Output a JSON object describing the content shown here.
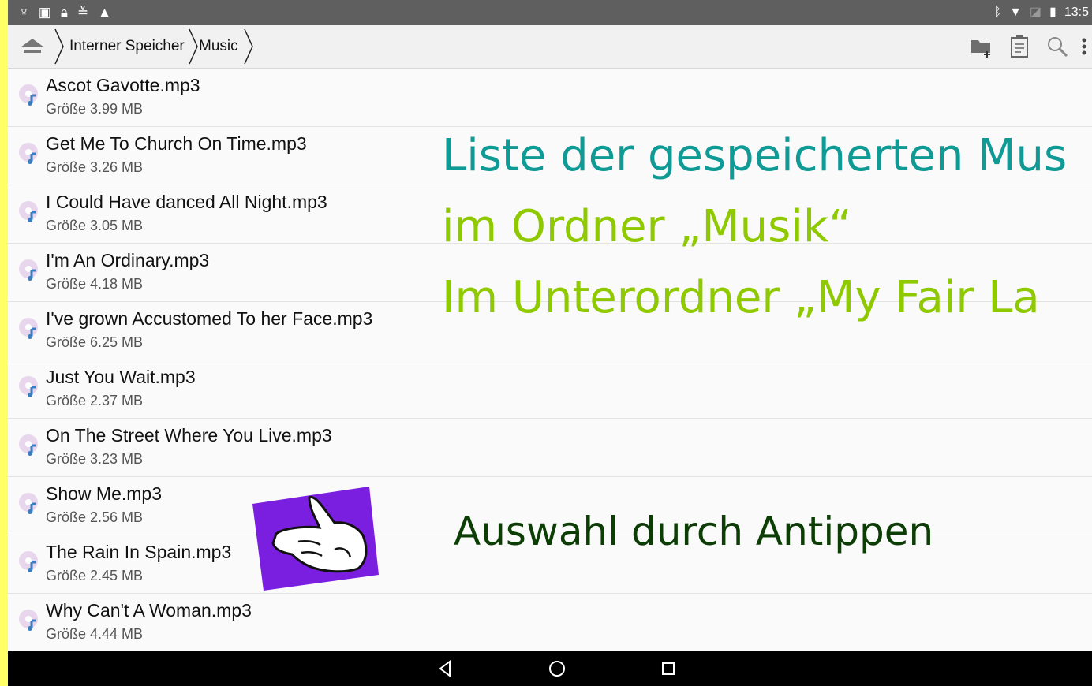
{
  "statusbar": {
    "left_icons": [
      "usb-icon",
      "image-icon",
      "lock-icon",
      "download-done-icon",
      "warning-icon"
    ],
    "right_icons": [
      "bluetooth-icon",
      "wifi-icon",
      "no-sim-icon",
      "battery-icon"
    ],
    "time": "13:5"
  },
  "breadcrumb": {
    "home_icon": "home-icon",
    "items": [
      "Interner Speicher",
      "Music"
    ]
  },
  "toolbar": {
    "icons": [
      "new-folder-icon",
      "clipboard-icon",
      "search-icon",
      "more-vert-icon"
    ]
  },
  "files": [
    {
      "name": "Ascot Gavotte.mp3",
      "size": "Größe 3.99 MB"
    },
    {
      "name": "Get Me To Church On Time.mp3",
      "size": "Größe 3.26 MB"
    },
    {
      "name": "I Could Have danced All Night.mp3",
      "size": "Größe 3.05 MB"
    },
    {
      "name": "I'm An Ordinary.mp3",
      "size": "Größe 4.18 MB"
    },
    {
      "name": "I've grown Accustomed To her Face.mp3",
      "size": "Größe 6.25 MB"
    },
    {
      "name": "Just You Wait.mp3",
      "size": "Größe 2.37 MB"
    },
    {
      "name": "On The Street Where You Live.mp3",
      "size": "Größe 3.23 MB"
    },
    {
      "name": "Show Me.mp3",
      "size": "Größe 2.56 MB"
    },
    {
      "name": "The Rain In Spain.mp3",
      "size": "Größe 2.45 MB"
    },
    {
      "name": "Why Can't A Woman.mp3",
      "size": "Größe 4.44 MB"
    }
  ],
  "annotations": {
    "line1": "Liste der gespeicherten Mus",
    "line2": "im Ordner „Musik“",
    "line3": "Im Unterordner „My Fair La",
    "hint": "Auswahl durch Antippen"
  },
  "colors": {
    "teal": "#0f9a96",
    "lime": "#8fc900",
    "dark_green": "#0b3d05",
    "border": "#ffff66",
    "hand_bg": "#7a1fe0"
  },
  "navbar": {
    "icons": [
      "back-icon",
      "home-circle-icon",
      "recents-icon"
    ]
  }
}
